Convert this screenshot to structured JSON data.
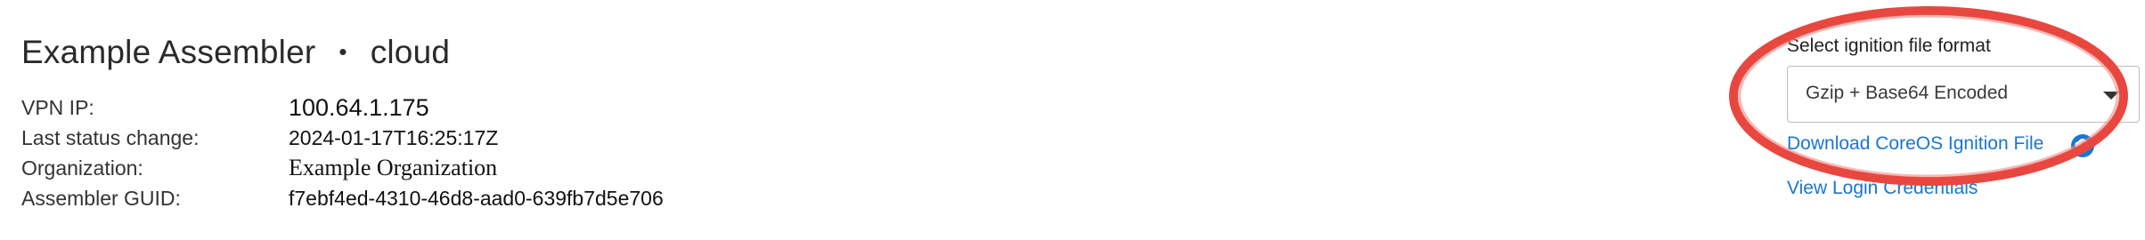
{
  "header": {
    "name": "Example Assembler",
    "separator": "•",
    "location": "cloud"
  },
  "details": [
    {
      "label": "VPN IP:",
      "value": "100.64.1.175"
    },
    {
      "label": "Last status change:",
      "value": "2024-01-17T16:25:17Z"
    },
    {
      "label": "Organization:",
      "value": "Example Organization"
    },
    {
      "label": "Assembler GUID:",
      "value": "f7ebf4ed-4310-46d8-aad0-639fb7d5e706"
    }
  ],
  "ignition": {
    "select_label": "Select ignition file format",
    "selected_format": "Gzip + Base64 Encoded",
    "download_label": "Download CoreOS Ignition File",
    "download_icon": "cloud-download-icon",
    "view_credentials_label": "View Login Credentials"
  },
  "colors": {
    "link": "#1976d2",
    "highlight": "#e8473f"
  }
}
